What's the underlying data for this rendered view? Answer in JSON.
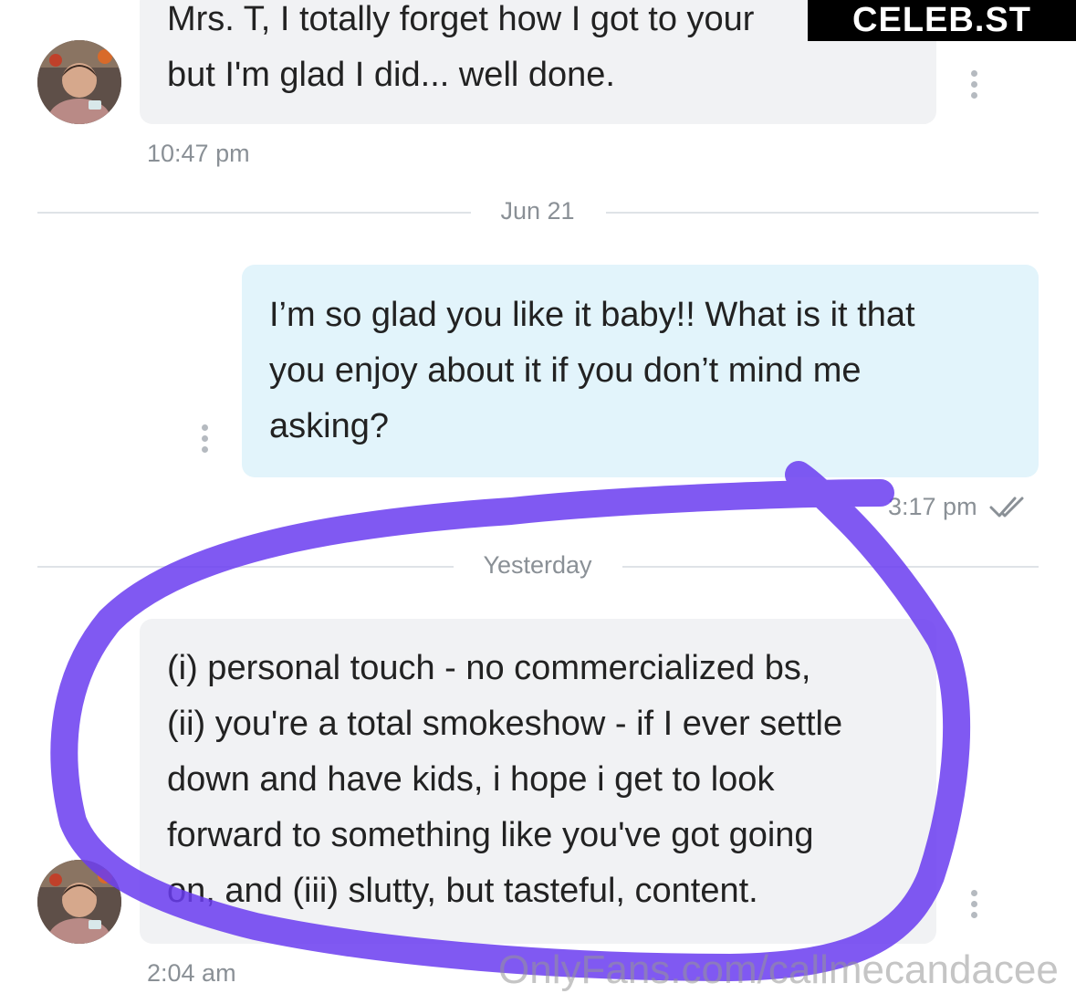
{
  "banner": {
    "label": "CELEB.ST"
  },
  "messages": [
    {
      "lines": [
        "Mrs. T, I totally forget how I got to your",
        "but I'm glad I did... well done."
      ],
      "time": "10:47 pm"
    },
    {
      "date_divider": "Jun 21",
      "lines": [
        "I’m so glad you like it baby!! What is it that",
        "you enjoy about it if you don’t mind me",
        "asking?"
      ],
      "time": "3:17 pm"
    },
    {
      "date_divider": "Yesterday",
      "lines": [
        "(i) personal touch - no commercialized bs,",
        "(ii) you're a total smokeshow - if I ever settle",
        "down and have kids, i hope i get to look",
        "forward to something like you've got going",
        "on, and (iii) slutty, but tasteful, content."
      ],
      "time": "2:04 am"
    }
  ],
  "watermark": "OnlyFans.com/callmecandacee",
  "colors": {
    "incoming_bubble": "#f1f2f4",
    "outgoing_bubble": "#e2f4fb",
    "highlight_circle": "#6a3cf0",
    "banner_bg": "#000000"
  }
}
